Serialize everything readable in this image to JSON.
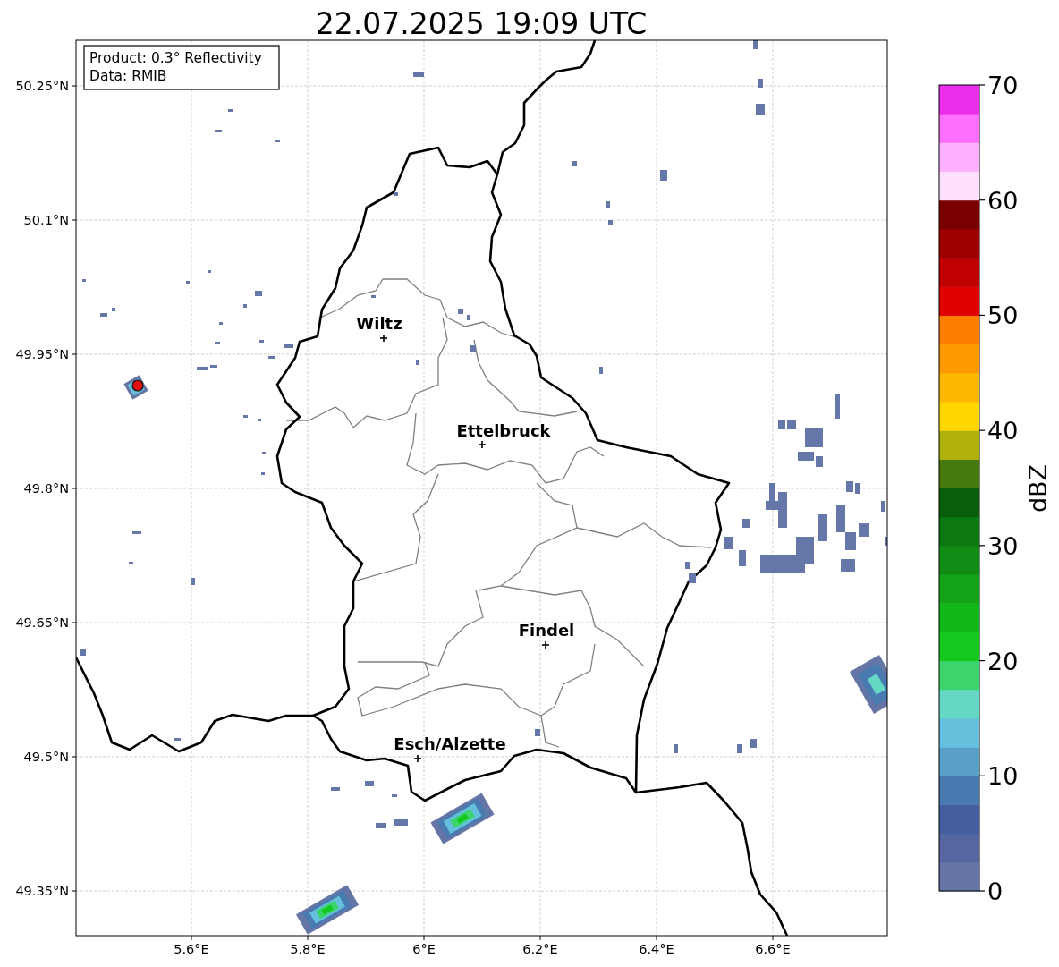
{
  "title": "22.07.2025 19:09 UTC",
  "info_box": {
    "lines": [
      "Product: 0.3° Reflectivity",
      "Data: RMIB"
    ]
  },
  "map": {
    "lon_ticks": [
      "5.6°E",
      "5.8°E",
      "6°E",
      "6.2°E",
      "6.4°E",
      "6.6°E"
    ],
    "lat_ticks": [
      "50.25°N",
      "50.1°N",
      "49.95°N",
      "49.8°N",
      "49.65°N",
      "49.5°N",
      "49.35°N"
    ],
    "cities": [
      {
        "name": "Wiltz"
      },
      {
        "name": "Ettelbruck"
      },
      {
        "name": "Findel"
      },
      {
        "name": "Esch/Alzette"
      }
    ]
  },
  "colorbar": {
    "label": "dBZ",
    "ticks": [
      "70",
      "60",
      "50",
      "40",
      "30",
      "20",
      "10",
      "0"
    ],
    "bins": [
      {
        "color": "#6576a6"
      },
      {
        "color": "#5566a0"
      },
      {
        "color": "#435e9e"
      },
      {
        "color": "#4a7bb0"
      },
      {
        "color": "#59a0c6"
      },
      {
        "color": "#64c0dc"
      },
      {
        "color": "#64d8c4"
      },
      {
        "color": "#3cd46c"
      },
      {
        "color": "#14c81e"
      },
      {
        "color": "#12b81a"
      },
      {
        "color": "#12a416"
      },
      {
        "color": "#108c14"
      },
      {
        "color": "#0c7812"
      },
      {
        "color": "#085e0c"
      },
      {
        "color": "#467a0c"
      },
      {
        "color": "#b0b00a"
      },
      {
        "color": "#ffd600"
      },
      {
        "color": "#ffb800"
      },
      {
        "color": "#ff9a00"
      },
      {
        "color": "#ff7e00"
      },
      {
        "color": "#e00000"
      },
      {
        "color": "#c00000"
      },
      {
        "color": "#9c0000"
      },
      {
        "color": "#7a0000"
      },
      {
        "color": "#ffe0ff"
      },
      {
        "color": "#ffb0ff"
      },
      {
        "color": "#ff6eff"
      },
      {
        "color": "#ea2eea"
      }
    ]
  }
}
